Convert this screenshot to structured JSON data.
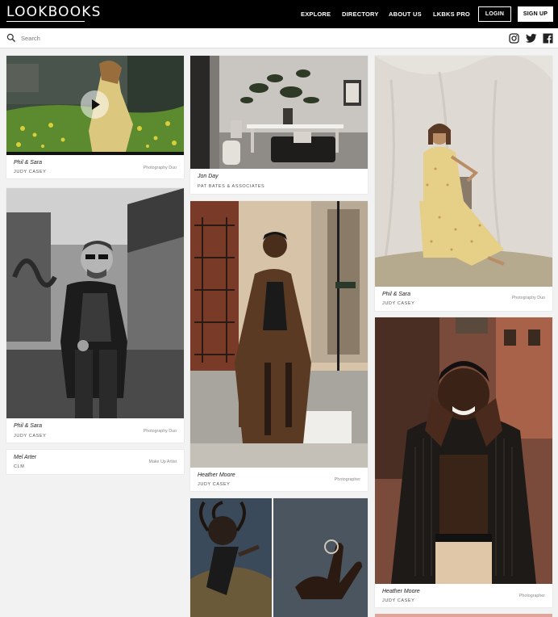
{
  "header": {
    "logo": "LOOKBOOKS",
    "nav": [
      "EXPLORE",
      "DIRECTORY",
      "ABOUT US",
      "LKBKS PRO"
    ],
    "login": "LOGIN",
    "signup": "SIGN UP"
  },
  "search": {
    "placeholder": "Search"
  },
  "social": [
    "instagram-icon",
    "twitter-icon",
    "facebook-icon"
  ],
  "colors": {
    "header_bg": "#000000",
    "page_bg": "#f2f2f2",
    "card_bg": "#ffffff"
  },
  "cards": [
    {
      "name": "Phil & Sara",
      "agency": "JUDY CASEY",
      "role": "Photography Duo",
      "media": "video"
    },
    {
      "name": "Phil & Sara",
      "agency": "JUDY CASEY",
      "role": "Photography Duo"
    },
    {
      "name": "Mel Arter",
      "agency": "CLM",
      "role": "Make Up Artist"
    },
    {
      "name": "Jon Day",
      "agency": "PAT BATES & ASSOCIATES",
      "role": ""
    },
    {
      "name": "Heather Moore",
      "agency": "JUDY CASEY",
      "role": "Photographer"
    },
    {
      "name": "Phil & Sara",
      "agency": "JUDY CASEY",
      "role": "Photography Duo"
    },
    {
      "name": "Heather Moore",
      "agency": "JUDY CASEY",
      "role": "Photographer"
    }
  ]
}
